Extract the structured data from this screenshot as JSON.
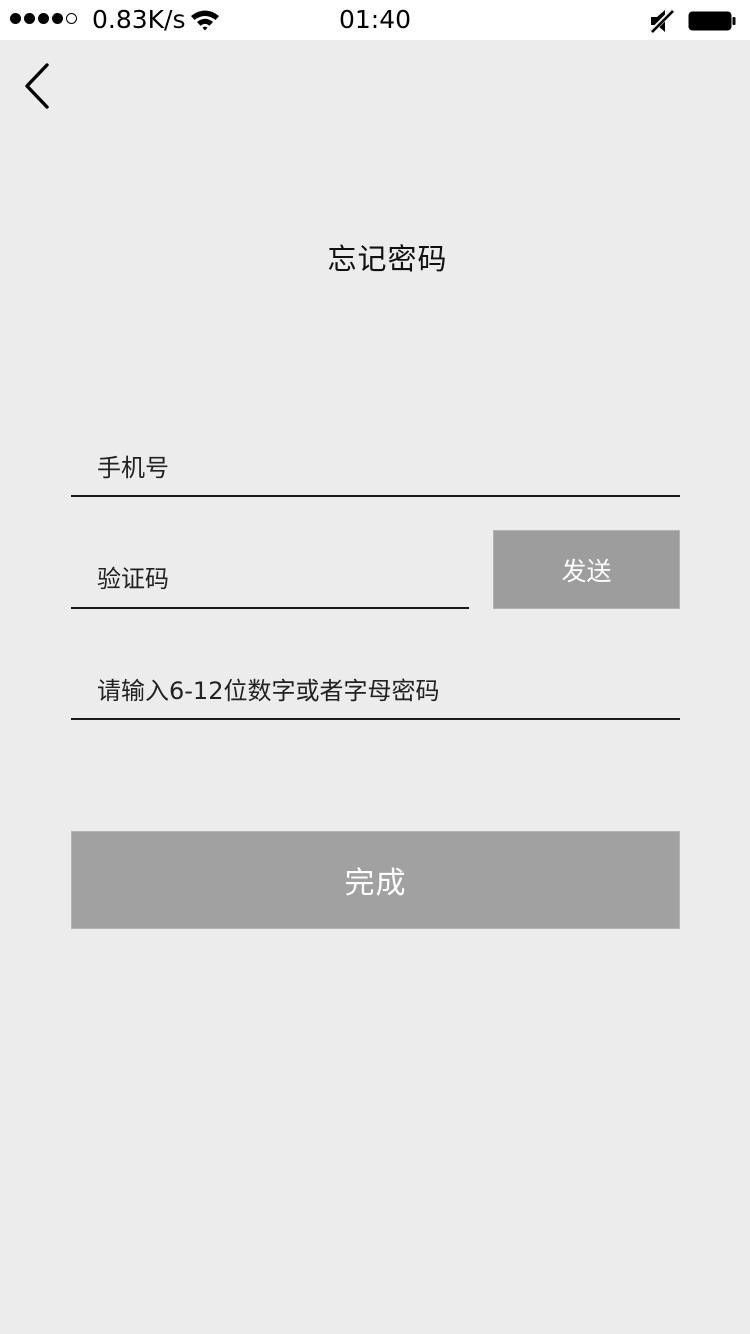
{
  "status_bar": {
    "signal_bars_filled": 4,
    "signal_bars_total": 5,
    "network_speed": "0.83K/s",
    "time": "01:40",
    "icons": [
      "signal-icon",
      "wifi-icon",
      "mute-icon",
      "battery-icon"
    ]
  },
  "nav": {
    "back_icon": "chevron-left-icon"
  },
  "page": {
    "title": "忘记密码"
  },
  "form": {
    "phone_placeholder": "手机号",
    "code_placeholder": "验证码",
    "send_label": "发送",
    "password_placeholder": "请输入6-12位数字或者字母密码",
    "submit_label": "完成"
  },
  "colors": {
    "background": "#ececec",
    "button": "#9d9d9d",
    "button_text": "#ffffff"
  }
}
